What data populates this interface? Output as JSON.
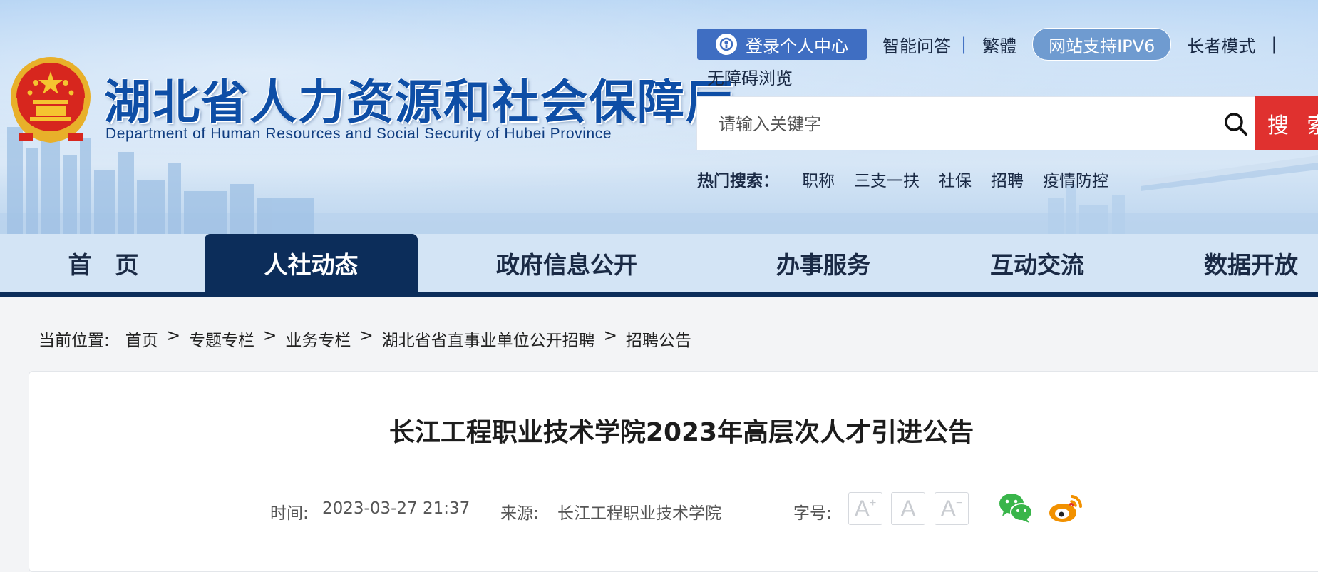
{
  "header": {
    "title": "湖北省人力资源和社会保障厅",
    "subtitle": "Department of Human Resources and Social Security of Hubei Province",
    "top_links": {
      "login": "登录个人中心",
      "qa": "智能问答",
      "sep": "|",
      "traditional": "繁體",
      "ipv6": "网站支持IPV6",
      "elder": "长者模式",
      "sep2": "|",
      "accessible": "无障碍浏览"
    },
    "search": {
      "placeholder": "请输入关键字",
      "button": "搜 索"
    },
    "hot_search": {
      "label": "热门搜索：",
      "items": [
        "职称",
        "三支一扶",
        "社保",
        "招聘",
        "疫情防控"
      ]
    }
  },
  "nav": {
    "items": [
      "首　页",
      "人社动态",
      "政府信息公开",
      "办事服务",
      "互动交流",
      "数据开放"
    ],
    "active_index": 1
  },
  "breadcrumb": {
    "label": "当前位置:",
    "items": [
      "首页",
      "专题专栏",
      "业务专栏",
      "湖北省省直事业单位公开招聘",
      "招聘公告"
    ],
    "separator": ">"
  },
  "article": {
    "title": "长江工程职业技术学院2023年高层次人才引进公告",
    "time_label": "时间:",
    "time": "2023-03-27 21:37",
    "source_label": "来源:",
    "source": "长江工程职业技术学院",
    "font_size_label": "字号:",
    "font_sizes": {
      "larger": "A",
      "normal": "A",
      "smaller": "A"
    },
    "share": [
      "wechat-icon",
      "weibo-icon"
    ]
  },
  "colors": {
    "primary_blue": "#0e4ea6",
    "nav_dark": "#0c2d5a",
    "search_red": "#e0312f",
    "login_blue": "#3f6ec2"
  }
}
